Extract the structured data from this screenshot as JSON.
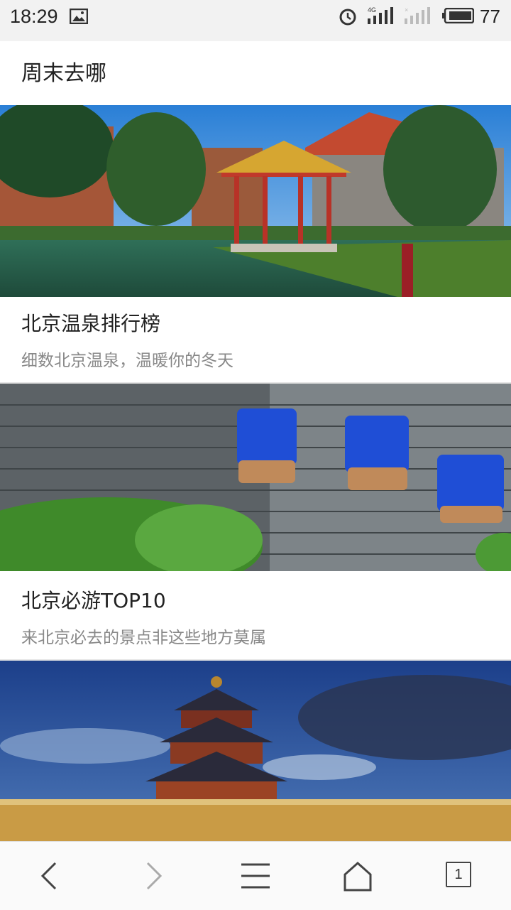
{
  "status_bar": {
    "time": "18:29",
    "battery": "77",
    "icons": [
      "image-icon",
      "alarm-icon",
      "signal-4g-icon",
      "signal-no-sim-icon",
      "battery-icon"
    ]
  },
  "header": {
    "title": "周末去哪"
  },
  "cards": [
    {
      "title": "北京温泉排行榜",
      "subtitle": "细数北京温泉，温暖你的冬天",
      "image": "hot-spring-pavilion-photo"
    },
    {
      "title": "北京必游TOP10",
      "subtitle": "来北京必去的景点非这些地方莫属",
      "image": "birdcages-on-brick-wall-photo"
    },
    {
      "image": "temple-of-heaven-photo"
    }
  ],
  "bottom_nav": {
    "items": [
      "back-icon",
      "forward-icon",
      "menu-icon",
      "home-icon",
      "tabs-icon"
    ],
    "tab_count": "1"
  },
  "colors": {
    "status_bg": "#f2f2f2",
    "text": "#222222",
    "subtext": "#888888",
    "divider": "#e6e6e6"
  }
}
